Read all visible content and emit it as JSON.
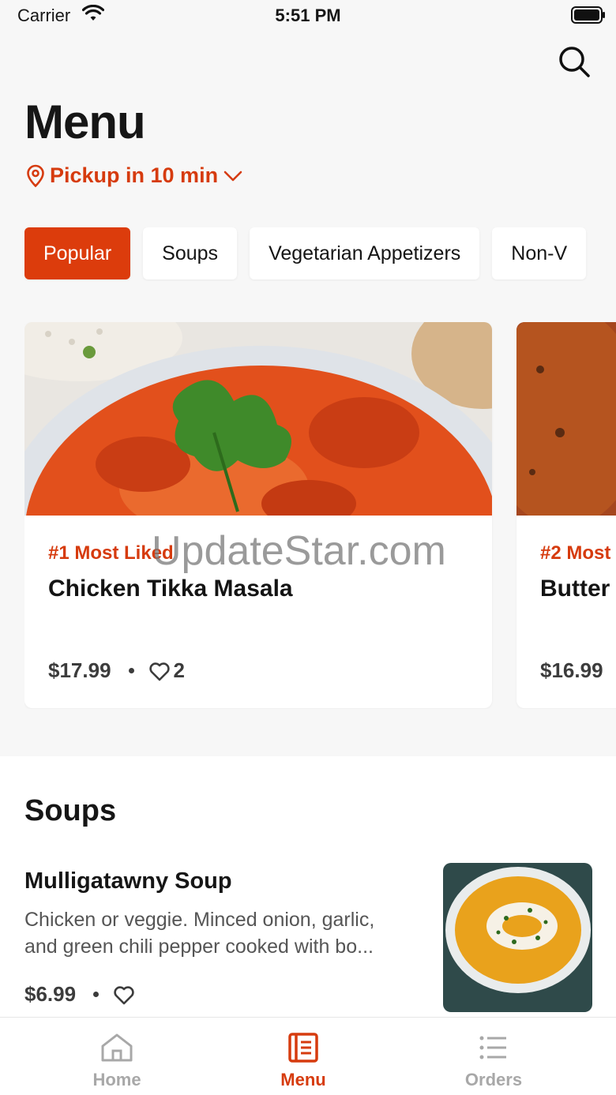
{
  "status_bar": {
    "carrier": "Carrier",
    "time": "5:51 PM"
  },
  "header": {
    "title": "Menu",
    "pickup": "Pickup in 10 min"
  },
  "categories": [
    "Popular",
    "Soups",
    "Vegetarian Appetizers",
    "Non-V"
  ],
  "popular": [
    {
      "rank": "#1 Most Liked",
      "name": "Chicken Tikka Masala",
      "price": "$17.99",
      "likes": "2"
    },
    {
      "rank": "#2 Most",
      "name": "Butter",
      "price": "$16.99"
    }
  ],
  "watermark": "UpdateStar.com",
  "soups": {
    "title": "Soups",
    "items": [
      {
        "name": "Mulligatawny Soup",
        "desc_line1": "Chicken or veggie. Minced onion, garlic,",
        "desc_line2": "and green chili pepper cooked with bo...",
        "price": "$6.99"
      }
    ]
  },
  "tabs": [
    {
      "label": "Home",
      "icon": "home-icon"
    },
    {
      "label": "Menu",
      "icon": "menu-icon"
    },
    {
      "label": "Orders",
      "icon": "list-icon"
    }
  ],
  "colors": {
    "accent": "#dc3c0c",
    "background": "#f7f7f7"
  }
}
